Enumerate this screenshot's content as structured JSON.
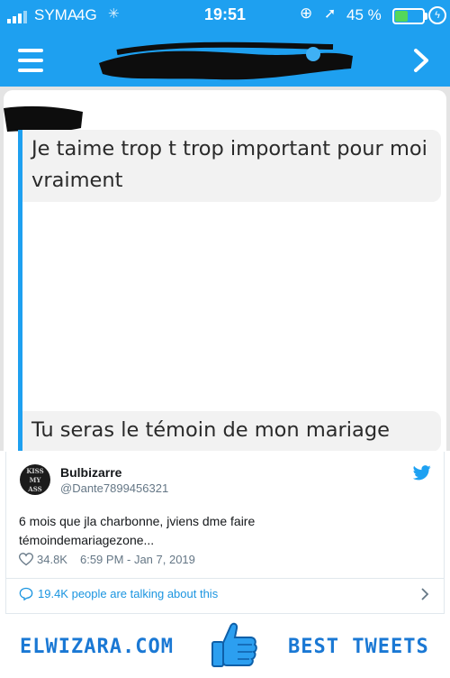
{
  "status_bar": {
    "carrier": "SYMA",
    "network": "4G",
    "time": "19:51",
    "battery_percent": "45 %",
    "battery_level": 0.45
  },
  "chat": {
    "message_1": "Je taime trop t trop important pour moi vraiment",
    "message_2": "Tu seras le témoin de mon mariage"
  },
  "tweet": {
    "display_name": "Bulbizarre",
    "handle": "@Dante7899456321",
    "avatar_text": [
      "KISS",
      "MY",
      "ASS"
    ],
    "text_line_1": "6 mois que jla charbonne, jviens dme faire",
    "text_line_2": "témoindemariagezone...",
    "likes": "34.8K",
    "timestamp": "6:59 PM - Jan 7, 2019",
    "talking": "19.4K people are talking about this"
  },
  "brand": {
    "left": "ELWIZARA.COM",
    "right": "BEST TWEETS"
  },
  "colors": {
    "twitter_blue": "#1ea0f0",
    "brand_blue": "#1a78d4",
    "battery_green": "#53d75a",
    "link_blue": "#1b95e0"
  },
  "icons": [
    "signal-icon",
    "lock-rotation-icon",
    "location-icon",
    "battery-icon",
    "menu-icon",
    "chevron-right-icon",
    "twitter-bird-icon",
    "heart-icon",
    "comment-icon",
    "thumbs-up-icon"
  ]
}
